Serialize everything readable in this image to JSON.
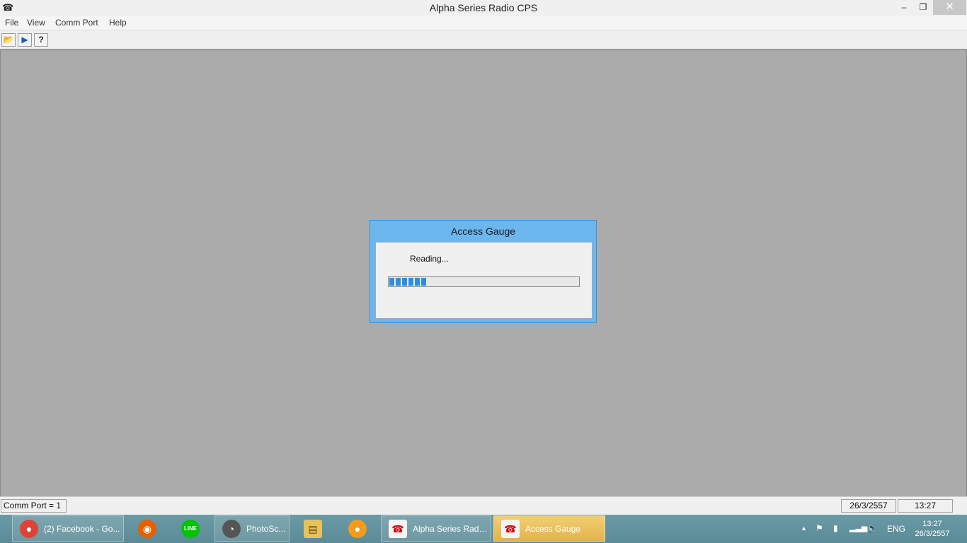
{
  "window": {
    "title": "Alpha Series Radio CPS",
    "min_glyph": "–",
    "max_glyph": "❐",
    "close_glyph": "✕"
  },
  "menu": [
    {
      "label": "File"
    },
    {
      "label": "View"
    },
    {
      "label": "Comm Port"
    },
    {
      "label": "Help"
    }
  ],
  "toolbar": {
    "buttons": [
      {
        "icon": "open-folder-icon",
        "glyph": "📂"
      },
      {
        "icon": "radio-transfer-icon",
        "glyph": "▶"
      },
      {
        "icon": "help-icon",
        "glyph": "?"
      }
    ]
  },
  "dialog": {
    "title": "Access Gauge",
    "message": "Reading...",
    "progress": 0.2
  },
  "status": {
    "comm_port": "Comm Port = 1",
    "date": "26/3/2557",
    "time": "13:27"
  },
  "taskbar": {
    "items": [
      {
        "label": "(2) Facebook - Go...",
        "icon": "chrome-icon"
      },
      {
        "label": "",
        "icon": "firefox-icon"
      },
      {
        "label": "",
        "icon": "line-icon"
      },
      {
        "label": "PhotoSc...",
        "icon": "photoscape-icon"
      },
      {
        "label": "",
        "icon": "file-explorer-icon"
      },
      {
        "label": "",
        "icon": "media-player-icon"
      },
      {
        "label": "Alpha Series Radi...",
        "icon": "radio-cps-icon"
      },
      {
        "label": "Access Gauge",
        "icon": "radio-cps-icon"
      }
    ],
    "tray": {
      "lang": "ENG",
      "time": "13:27",
      "date": "26/3/2557"
    }
  },
  "colors": {
    "workspace": "#ababab",
    "dialog_frame": "#6cb6ee",
    "progress_fill": "#2e8fe0",
    "active_task": "#e3b24d"
  }
}
